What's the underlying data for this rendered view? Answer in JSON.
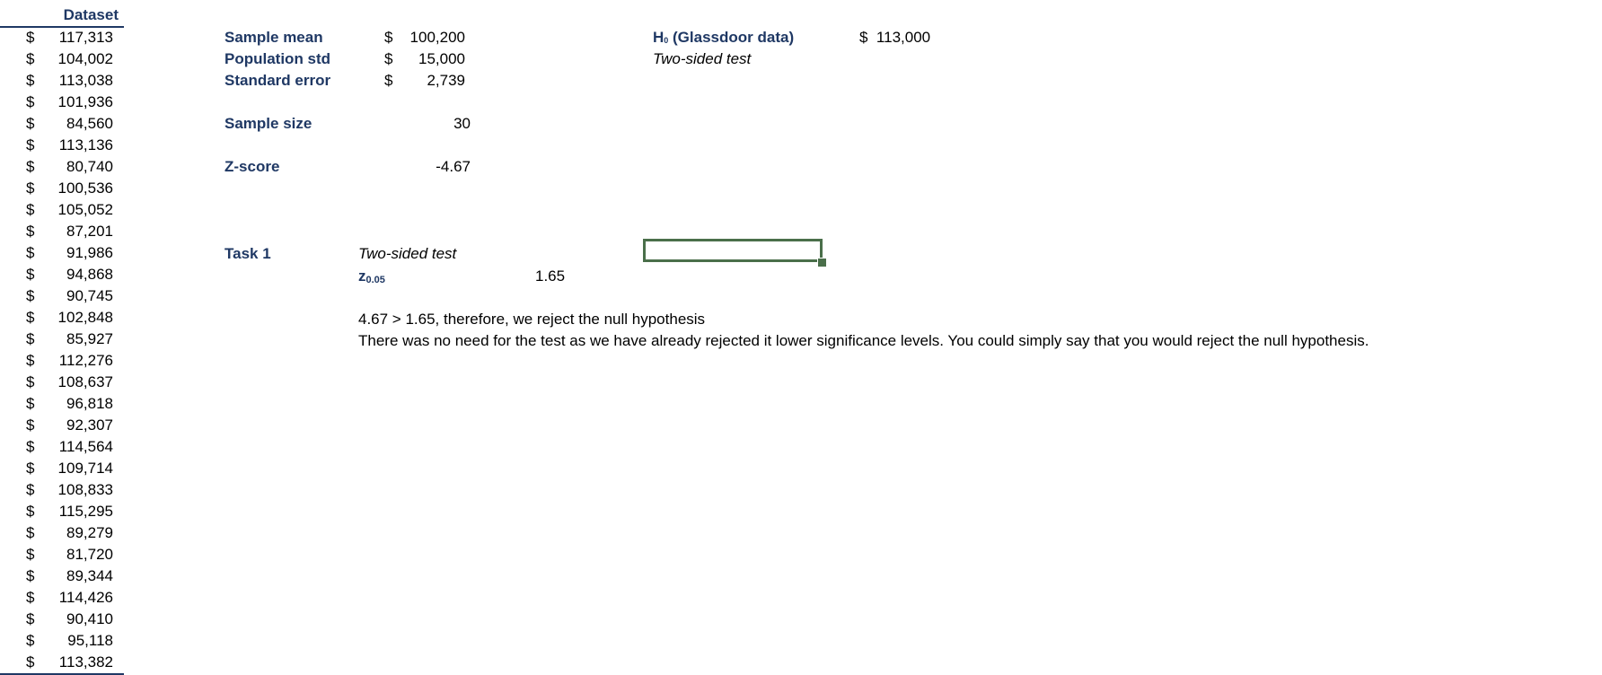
{
  "dataset": {
    "header": "Dataset",
    "currency": "$",
    "values": [
      "117,313",
      "104,002",
      "113,038",
      "101,936",
      "84,560",
      "113,136",
      "80,740",
      "100,536",
      "105,052",
      "87,201",
      "91,986",
      "94,868",
      "90,745",
      "102,848",
      "85,927",
      "112,276",
      "108,637",
      "96,818",
      "92,307",
      "114,564",
      "109,714",
      "108,833",
      "115,295",
      "89,279",
      "81,720",
      "89,344",
      "114,426",
      "90,410",
      "95,118",
      "113,382"
    ]
  },
  "stats": {
    "sample_mean": {
      "label": "Sample mean",
      "currency": "$",
      "value": "100,200"
    },
    "population_std": {
      "label": "Population std",
      "currency": "$",
      "value": "15,000"
    },
    "standard_error": {
      "label": "Standard error",
      "currency": "$",
      "value": "2,739"
    },
    "sample_size": {
      "label": "Sample size",
      "value": "30"
    },
    "z_score": {
      "label": "Z-score",
      "value": "-4.67"
    }
  },
  "hypothesis": {
    "label_main": "H",
    "label_sub": "0",
    "label_rest": " (Glassdoor data)",
    "currency": "$",
    "value": "113,000",
    "test_type": "Two-sided test"
  },
  "task1": {
    "label": "Task 1",
    "test_type": "Two-sided test",
    "z_main": "z",
    "z_sub": "0.05",
    "z_value": "1.65",
    "conclusion": "4.67 > 1.65, therefore, we reject the null hypothesis",
    "note": "There was no need for the test as we have already rejected it lower significance levels. You could simply say that you would reject the null hypothesis."
  },
  "colors": {
    "header_navy": "#1f3864",
    "selection_green": "#4a6f4a"
  }
}
